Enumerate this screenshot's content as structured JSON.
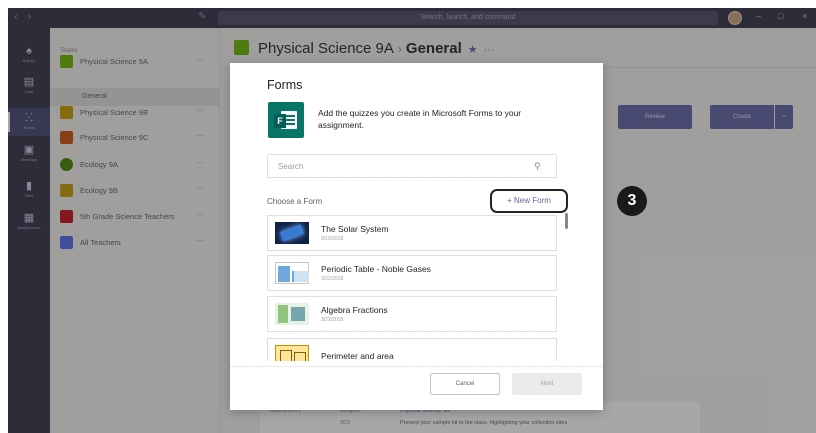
{
  "titlebar": {
    "search_placeholder": "Search, launch, and command"
  },
  "rail": {
    "items": [
      {
        "label": "Activity",
        "icon": "bell-icon"
      },
      {
        "label": "Chat",
        "icon": "chat-icon"
      },
      {
        "label": "Teams",
        "icon": "teams-icon"
      },
      {
        "label": "Meetings",
        "icon": "calendar-icon"
      },
      {
        "label": "Files",
        "icon": "file-icon"
      },
      {
        "label": "Assignments",
        "icon": "assignments-icon"
      }
    ]
  },
  "teams_panel": {
    "header": "Teams",
    "teams": [
      {
        "name": "Physical Science 9A",
        "color": "#6bb700"
      },
      {
        "name": "Physical Science 9B",
        "color": "#c19c00"
      },
      {
        "name": "Physical Science 9C",
        "color": "#ca5010"
      },
      {
        "name": "Ecology 9A",
        "color": "#498205"
      },
      {
        "name": "Ecology 9B",
        "color": "#c19c00"
      },
      {
        "name": "5th Grade Science Teachers",
        "color": "#c50f1f"
      },
      {
        "name": "All Teachers",
        "color": "#4f6bed"
      }
    ],
    "channel": "General"
  },
  "main": {
    "team_name": "Physical Science 9A",
    "separator": "›",
    "channel": "General",
    "review_label": "Review",
    "create_label": "Create",
    "card": {
      "col1": "Assessment 2",
      "col2": "Assigned",
      "col3": "3/23",
      "title": "Physical Science 9A",
      "text": "Present your sample kit to the class, highlighting your collection sites"
    }
  },
  "dialog": {
    "title": "Forms",
    "description": "Add the quizzes you create in Microsoft Forms to your assignment.",
    "logo_letter": "F",
    "search_placeholder": "Search",
    "choose_label": "Choose a Form",
    "new_form_label": "+ New Form",
    "forms": [
      {
        "name": "The Solar System",
        "date": "3/10/2018"
      },
      {
        "name": "Periodic Table - Noble Gases",
        "date": "3/22/2018"
      },
      {
        "name": "Algebra Fractions",
        "date": "3/22/2018"
      },
      {
        "name": "Perimeter and area",
        "date": ""
      }
    ],
    "cancel_label": "Cancel",
    "next_label": "Next"
  },
  "callout": {
    "step": "3"
  },
  "colors": {
    "brand": "#6264a7",
    "titlebar": "#33344a",
    "forms_green": "#077568",
    "callout": "#1b1a19"
  }
}
